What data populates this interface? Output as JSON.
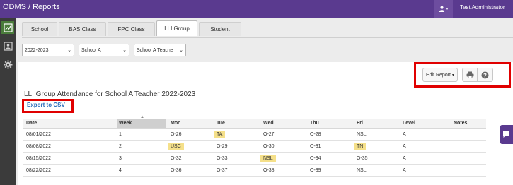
{
  "app": {
    "name": "ODMS",
    "section": "Reports",
    "user_name": "Test Administrator"
  },
  "tabs": [
    {
      "label": "School"
    },
    {
      "label": "BAS Class"
    },
    {
      "label": "FPC Class"
    },
    {
      "label": "LLI Group"
    },
    {
      "label": "Student"
    }
  ],
  "filters": {
    "year": "2022-2023",
    "school": "School A",
    "teacher": "School A Teache"
  },
  "toolbar": {
    "edit_report_label": "Edit Report"
  },
  "report": {
    "title": "LLI Group Attendance for School A Teacher 2022-2023",
    "export_label": "Export to CSV"
  },
  "table": {
    "headers": [
      "Date",
      "Week",
      "Mon",
      "Tue",
      "Wed",
      "Thu",
      "Fri",
      "Level",
      "Notes"
    ],
    "rows": [
      [
        "08/01/2022",
        "1",
        "O-26",
        "TA",
        "O-27",
        "O-28",
        "NSL",
        "A",
        ""
      ],
      [
        "08/08/2022",
        "2",
        "USC",
        "O-29",
        "O-30",
        "O-31",
        "TN",
        "A",
        ""
      ],
      [
        "08/15/2022",
        "3",
        "O-32",
        "O-33",
        "NSL",
        "O-34",
        "O-35",
        "A",
        ""
      ],
      [
        "08/22/2022",
        "4",
        "O-36",
        "O-37",
        "O-38",
        "O-39",
        "NSL",
        "A",
        ""
      ]
    ]
  },
  "colors": {
    "brand": "#5a3a8f",
    "highlight": "#f5e08a",
    "annotation_red": "#e00000",
    "link": "#2a6ebb"
  }
}
